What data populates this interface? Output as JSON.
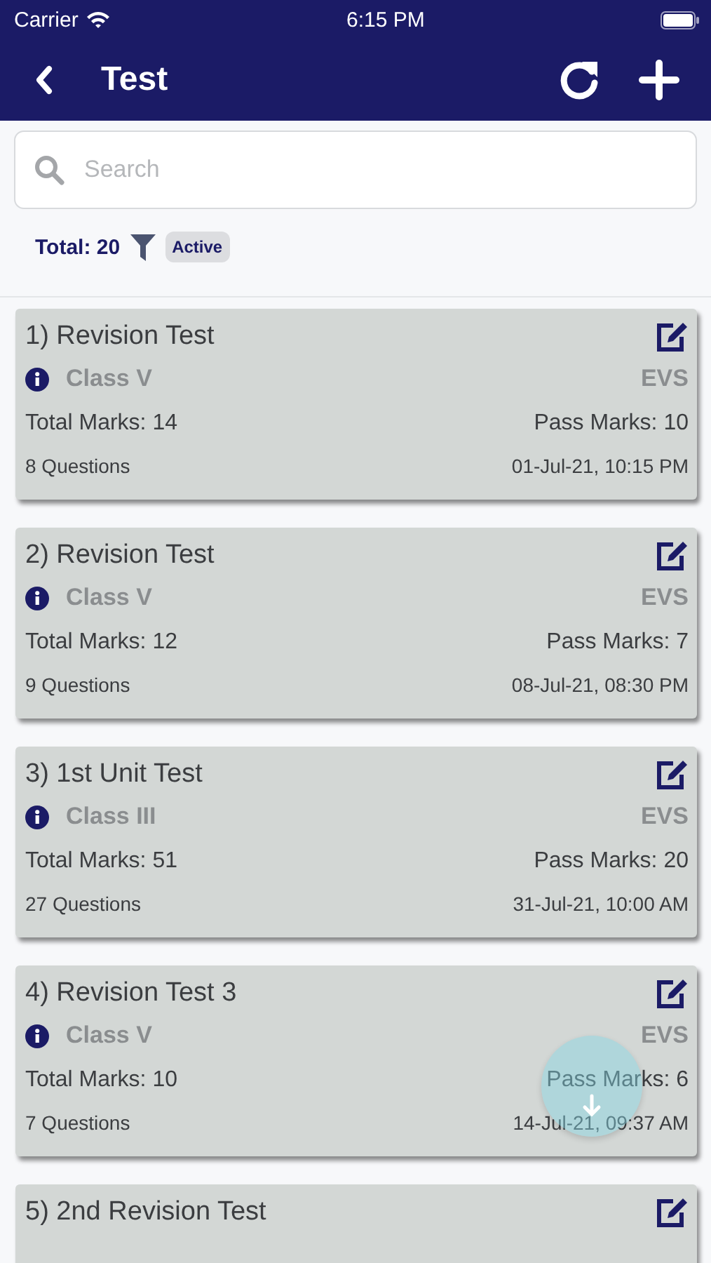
{
  "status_bar": {
    "carrier": "Carrier",
    "time": "6:15 PM"
  },
  "nav_bar": {
    "title": "Test"
  },
  "search": {
    "placeholder": "Search"
  },
  "summary": {
    "total": "Total: 20",
    "filter_tag": "Active"
  },
  "tests": [
    {
      "title": "1) Revision Test",
      "class": "Class V",
      "subject": "EVS",
      "total_marks": "Total Marks: 14",
      "pass_marks": "Pass Marks: 10",
      "questions": "8 Questions",
      "date": "01-Jul-21, 10:15 PM"
    },
    {
      "title": "2) Revision Test",
      "class": "Class V",
      "subject": "EVS",
      "total_marks": "Total Marks: 12",
      "pass_marks": "Pass Marks: 7",
      "questions": "9 Questions",
      "date": "08-Jul-21, 08:30 PM"
    },
    {
      "title": "3) 1st Unit Test",
      "class": "Class III",
      "subject": "EVS",
      "total_marks": "Total Marks: 51",
      "pass_marks": "Pass Marks: 20",
      "questions": "27 Questions",
      "date": "31-Jul-21, 10:00 AM"
    },
    {
      "title": "4) Revision Test 3",
      "class": "Class V",
      "subject": "EVS",
      "total_marks": "Total Marks: 10",
      "pass_marks": "Pass Marks: 6",
      "questions": "7 Questions",
      "date": "14-Jul-21, 09:37 AM"
    },
    {
      "title": "5) 2nd Revision Test"
    }
  ]
}
